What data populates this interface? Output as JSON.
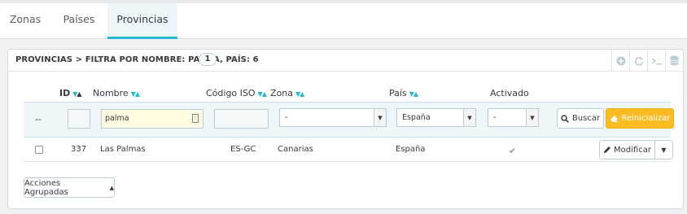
{
  "tabs": [
    {
      "label": "Zonas"
    },
    {
      "label": "Países"
    },
    {
      "label": "Provincias"
    }
  ],
  "panel": {
    "heading": "PROVINCIAS > FILTRA POR NOMBRE: PALMA, PAÍS: 6",
    "count": "1"
  },
  "columns": {
    "id": "ID",
    "nombre": "Nombre",
    "iso": "Código ISO",
    "zona": "Zona",
    "pais": "País",
    "activado": "Activado"
  },
  "filters": {
    "dash": "--",
    "id_value": "",
    "nombre_value": "palma",
    "iso_value": "",
    "zona_selected": "-",
    "pais_selected": "España",
    "activado_selected": "-",
    "search_label": "Buscar",
    "reset_label": "Reinicializar"
  },
  "rows": [
    {
      "id": "337",
      "nombre": "Las Palmas",
      "iso": "ES-GC",
      "zona": "Canarias",
      "pais": "España",
      "activado": true,
      "edit_label": "Modificar"
    }
  ],
  "bulk_actions_label": "Acciones Agrupadas",
  "colors": {
    "accent": "#25b9d7",
    "warning": "#fbbb22",
    "success": "#70b580"
  },
  "icons": [
    "plus-circle-icon",
    "refresh-icon",
    "terminal-icon",
    "database-icon",
    "search-icon",
    "eraser-icon",
    "pencil-icon",
    "caret-down-icon",
    "caret-up-icon",
    "check-icon",
    "keyboard-icon"
  ]
}
